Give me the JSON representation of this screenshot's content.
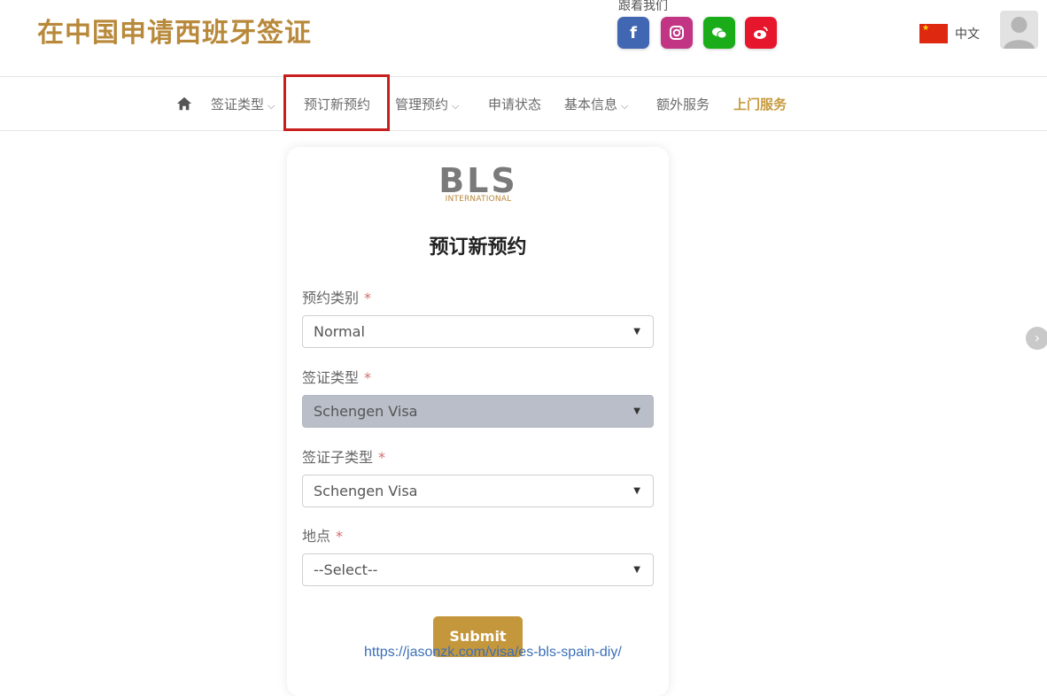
{
  "header": {
    "site_title": "在中国申请西班牙签证",
    "follow_label": "跟着我们",
    "language": "中文",
    "social": [
      {
        "name": "facebook",
        "color": "#4267b2",
        "glyph": "f"
      },
      {
        "name": "instagram",
        "color": "#c13584",
        "glyph": "◎"
      },
      {
        "name": "wechat",
        "color": "#1aad19",
        "glyph": "●"
      },
      {
        "name": "weibo",
        "color": "#e6162d",
        "glyph": "◉"
      }
    ]
  },
  "nav": {
    "items": [
      {
        "label": "签证类型",
        "has_dropdown": true
      },
      {
        "label": "预订新预约",
        "has_dropdown": false,
        "highlighted": true
      },
      {
        "label": "管理预约",
        "has_dropdown": true
      },
      {
        "label": "申请状态",
        "has_dropdown": false
      },
      {
        "label": "基本信息",
        "has_dropdown": true
      },
      {
        "label": "额外服务",
        "has_dropdown": false
      },
      {
        "label": "上门服务",
        "has_dropdown": false,
        "accent": true
      }
    ],
    "chevron": "⌵"
  },
  "form": {
    "logo_main": "BLS",
    "logo_sub": "INTERNATIONAL",
    "title": "预订新预约",
    "fields": [
      {
        "label": "预约类别",
        "required": "*",
        "value": "Normal"
      },
      {
        "label": "签证类型",
        "required": "*",
        "value": "Schengen Visa",
        "disabled": true
      },
      {
        "label": "签证子类型",
        "required": "*",
        "value": "Schengen Visa"
      },
      {
        "label": "地点",
        "required": "*",
        "value": "--Select--"
      }
    ],
    "select_arrow": "▼",
    "submit_label": "Submit"
  },
  "watermark": "https://jasonzk.com/visa/es-bls-spain-diy/",
  "colors": {
    "brand_gold": "#b8893a",
    "highlight_red": "#c81e1e"
  }
}
